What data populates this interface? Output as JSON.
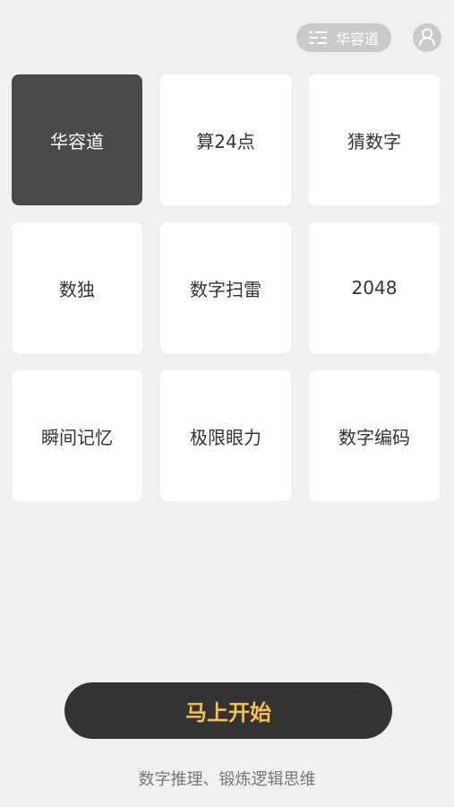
{
  "header": {
    "mode_icon": "sliders-icon",
    "mode_label": "华容道",
    "profile_icon": "user-icon"
  },
  "games": [
    {
      "label": "华容道",
      "selected": true
    },
    {
      "label": "算24点",
      "selected": false
    },
    {
      "label": "猜数字",
      "selected": false
    },
    {
      "label": "数独",
      "selected": false
    },
    {
      "label": "数字扫雷",
      "selected": false
    },
    {
      "label": "2048",
      "selected": false
    },
    {
      "label": "瞬间记忆",
      "selected": false
    },
    {
      "label": "极限眼力",
      "selected": false
    },
    {
      "label": "数字编码",
      "selected": false
    }
  ],
  "start_button": {
    "label": "马上开始"
  },
  "tagline": "数字推理、锻炼逻辑思维",
  "colors": {
    "background": "#eff0f2",
    "tile": "#ffffff",
    "tile_selected": "#4a4a4a",
    "button": "#333333",
    "button_text": "#f2c14e"
  }
}
